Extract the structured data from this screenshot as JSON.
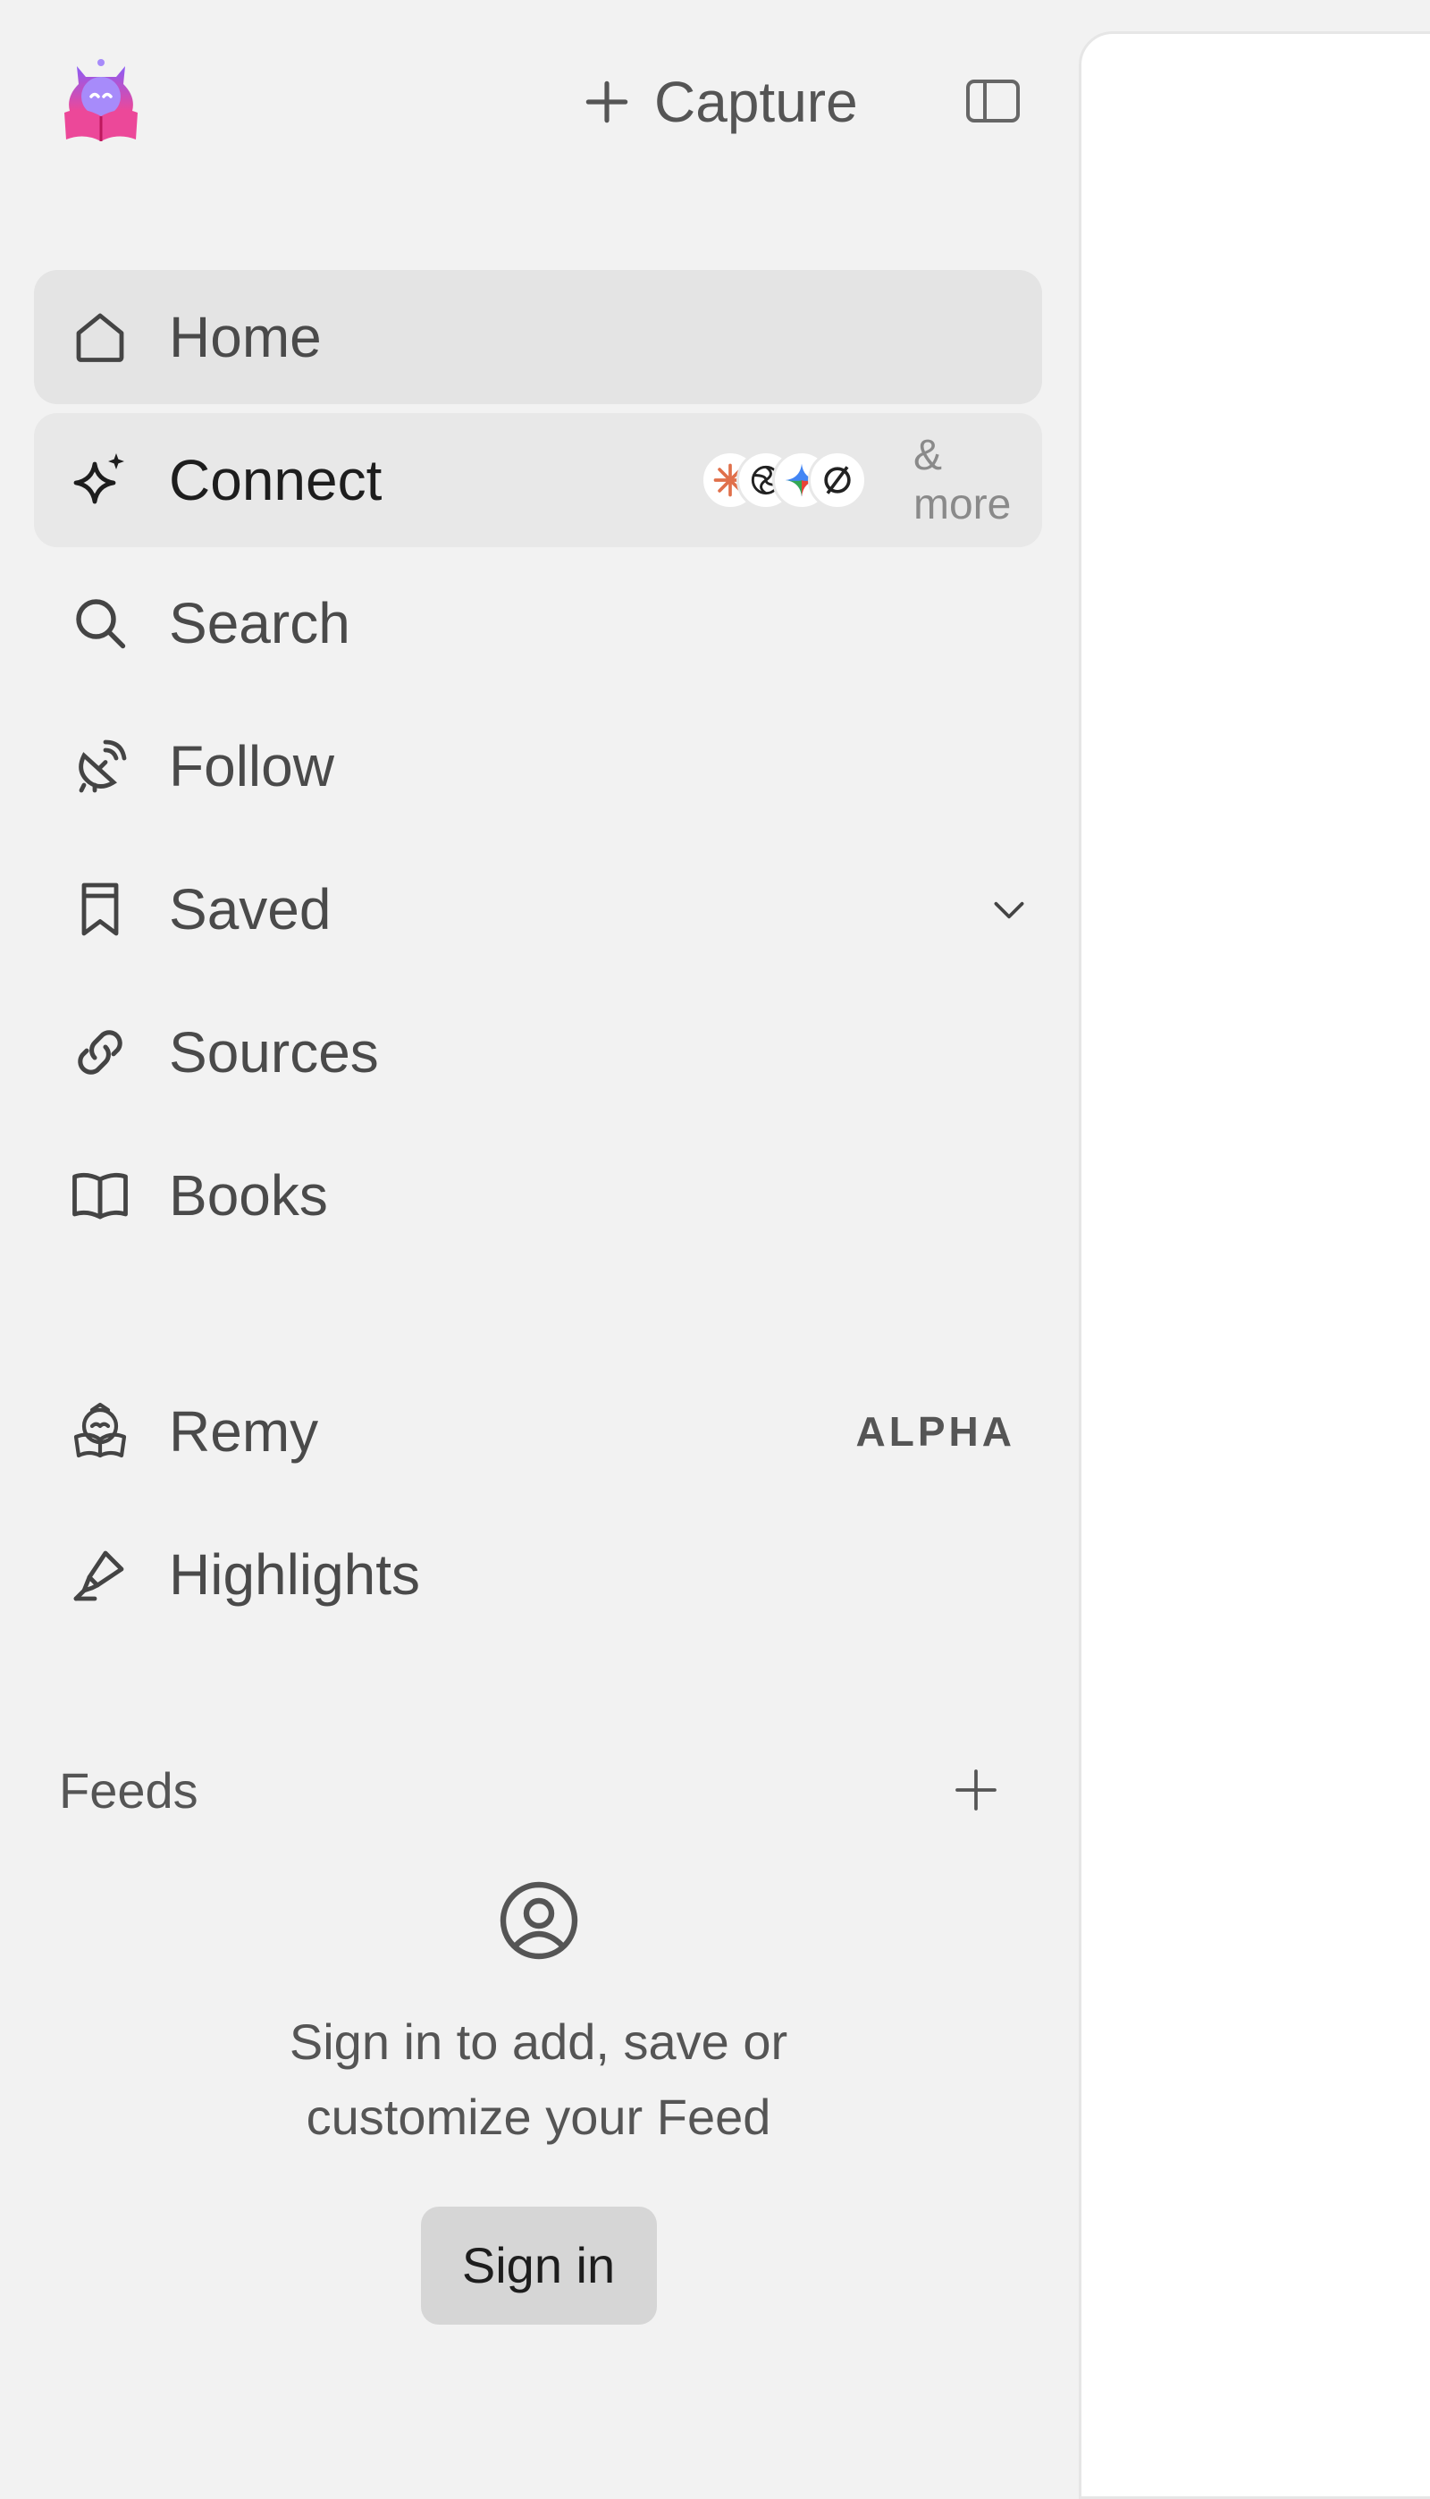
{
  "header": {
    "capture_label": "Capture",
    "logo_icon": "reading-mascot-icon",
    "capture_icon": "plus-icon",
    "toggle_icon": "sidebar-toggle-icon"
  },
  "nav": {
    "items": [
      {
        "label": "Home",
        "icon": "home-icon",
        "active": true
      },
      {
        "label": "Connect",
        "icon": "sparkle-icon",
        "more": "& more",
        "providers": [
          "claude-icon",
          "openai-icon",
          "gemini-icon",
          "perplexity-icon"
        ]
      },
      {
        "label": "Search",
        "icon": "search-icon"
      },
      {
        "label": "Follow",
        "icon": "satellite-icon"
      },
      {
        "label": "Saved",
        "icon": "bookmark-icon",
        "expander": "chevron-down-icon"
      },
      {
        "label": "Sources",
        "icon": "link-icon"
      },
      {
        "label": "Books",
        "icon": "book-open-icon"
      }
    ]
  },
  "secondary": {
    "items": [
      {
        "label": "Remy",
        "icon": "mascot-outline-icon",
        "badge": "ALPHA"
      },
      {
        "label": "Highlights",
        "icon": "highlighter-icon"
      }
    ]
  },
  "feeds": {
    "title": "Feeds",
    "add_icon": "plus-icon",
    "empty_icon": "user-circle-icon",
    "empty_message": "Sign in to add, save or customize your Feed",
    "signin_label": "Sign in"
  },
  "colors": {
    "sidebar_bg": "#f2f2f2",
    "active_bg": "#e4e4e4",
    "button_bg": "#d6d6d6",
    "logo_purple": "#7c3aed",
    "logo_pink": "#ec4899"
  }
}
